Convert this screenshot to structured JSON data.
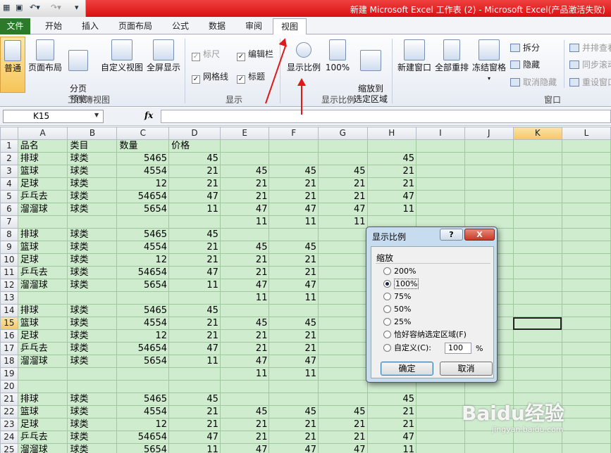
{
  "window": {
    "title": "新建 Microsoft Excel 工作表 (2) - Microsoft Excel(产品激活失败)"
  },
  "tabs": [
    {
      "label": "文件"
    },
    {
      "label": "开始"
    },
    {
      "label": "插入"
    },
    {
      "label": "页面布局"
    },
    {
      "label": "公式"
    },
    {
      "label": "数据"
    },
    {
      "label": "审阅"
    },
    {
      "label": "视图"
    }
  ],
  "ribbon": {
    "workbook_views": {
      "normal": "普通",
      "page_layout": "页面布局",
      "page_break": "分页\n预览",
      "custom_view": "自定义视图",
      "full_screen": "全屏显示",
      "group": "工作簿视图"
    },
    "show": {
      "ruler": "标尺",
      "formula_bar": "编辑栏",
      "gridlines": "网格线",
      "headings": "标题",
      "group": "显示"
    },
    "zoom": {
      "zoom": "显示比例",
      "zoom100": "100%",
      "zoom_selection": "缩放到\n选定区域",
      "group": "显示比例"
    },
    "window": {
      "new_window": "新建窗口",
      "arrange_all": "全部重排",
      "freeze": "冻结窗格",
      "split": "拆分",
      "hide": "隐藏",
      "unhide": "取消隐藏",
      "side_by_side": "并排查看",
      "sync_scroll": "同步滚动",
      "reset_pos": "重设窗口",
      "group": "窗口"
    }
  },
  "formula_bar": {
    "name_box": "K15",
    "fx": "fx",
    "value": ""
  },
  "columns": [
    "A",
    "B",
    "C",
    "D",
    "E",
    "F",
    "G",
    "H",
    "I",
    "J",
    "K",
    "L"
  ],
  "selected_column": "K",
  "selected_row": 15,
  "rows": [
    {
      "r": 1,
      "c": [
        "品名",
        "类目",
        "数量",
        "价格",
        "",
        "",
        "",
        "",
        ""
      ]
    },
    {
      "r": 2,
      "c": [
        "排球",
        "球类",
        "5465",
        "45",
        "",
        "",
        "",
        "45",
        ""
      ]
    },
    {
      "r": 3,
      "c": [
        "篮球",
        "球类",
        "4554",
        "21",
        "45",
        "45",
        "45",
        "21",
        ""
      ]
    },
    {
      "r": 4,
      "c": [
        "足球",
        "球类",
        "12",
        "21",
        "21",
        "21",
        "21",
        "21",
        ""
      ]
    },
    {
      "r": 5,
      "c": [
        "乒乓去",
        "球类",
        "54654",
        "47",
        "21",
        "21",
        "21",
        "47",
        ""
      ]
    },
    {
      "r": 6,
      "c": [
        "溜溜球",
        "球类",
        "5654",
        "11",
        "47",
        "47",
        "47",
        "11",
        ""
      ]
    },
    {
      "r": 7,
      "c": [
        "",
        "",
        "",
        "",
        "11",
        "11",
        "11",
        "",
        ""
      ]
    },
    {
      "r": 8,
      "c": [
        "排球",
        "球类",
        "5465",
        "45",
        "",
        "",
        "",
        "",
        ""
      ]
    },
    {
      "r": 9,
      "c": [
        "篮球",
        "球类",
        "4554",
        "21",
        "45",
        "45",
        "",
        "",
        ""
      ]
    },
    {
      "r": 10,
      "c": [
        "足球",
        "球类",
        "12",
        "21",
        "21",
        "21",
        "",
        "",
        ""
      ]
    },
    {
      "r": 11,
      "c": [
        "乒乓去",
        "球类",
        "54654",
        "47",
        "21",
        "21",
        "",
        "",
        ""
      ]
    },
    {
      "r": 12,
      "c": [
        "溜溜球",
        "球类",
        "5654",
        "11",
        "47",
        "47",
        "",
        "",
        ""
      ]
    },
    {
      "r": 13,
      "c": [
        "",
        "",
        "",
        "",
        "11",
        "11",
        "",
        "",
        ""
      ]
    },
    {
      "r": 14,
      "c": [
        "排球",
        "球类",
        "5465",
        "45",
        "",
        "",
        "",
        "",
        ""
      ]
    },
    {
      "r": 15,
      "c": [
        "篮球",
        "球类",
        "4554",
        "21",
        "45",
        "45",
        "",
        "",
        ""
      ]
    },
    {
      "r": 16,
      "c": [
        "足球",
        "球类",
        "12",
        "21",
        "21",
        "21",
        "",
        "",
        ""
      ]
    },
    {
      "r": 17,
      "c": [
        "乒乓去",
        "球类",
        "54654",
        "47",
        "21",
        "21",
        "",
        "",
        ""
      ]
    },
    {
      "r": 18,
      "c": [
        "溜溜球",
        "球类",
        "5654",
        "11",
        "47",
        "47",
        "",
        "",
        ""
      ]
    },
    {
      "r": 19,
      "c": [
        "",
        "",
        "",
        "",
        "11",
        "11",
        "",
        "",
        ""
      ]
    },
    {
      "r": 20,
      "c": [
        "",
        "",
        "",
        "",
        "",
        "",
        "",
        "",
        ""
      ]
    },
    {
      "r": 21,
      "c": [
        "排球",
        "球类",
        "5465",
        "45",
        "",
        "",
        "",
        "45",
        ""
      ]
    },
    {
      "r": 22,
      "c": [
        "篮球",
        "球类",
        "4554",
        "21",
        "45",
        "45",
        "45",
        "21",
        ""
      ]
    },
    {
      "r": 23,
      "c": [
        "足球",
        "球类",
        "12",
        "21",
        "21",
        "21",
        "21",
        "21",
        ""
      ]
    },
    {
      "r": 24,
      "c": [
        "乒乓去",
        "球类",
        "54654",
        "47",
        "21",
        "21",
        "21",
        "47",
        ""
      ]
    },
    {
      "r": 25,
      "c": [
        "溜溜球",
        "球类",
        "5654",
        "11",
        "47",
        "47",
        "47",
        "11",
        ""
      ]
    }
  ],
  "dialog": {
    "title": "显示比例",
    "help": "?",
    "close": "X",
    "legend": "缩放",
    "options": [
      "200%",
      "100%",
      "75%",
      "50%",
      "25%",
      "恰好容纳选定区域(F)",
      "自定义(C):"
    ],
    "selected": "100%",
    "custom_value": "100",
    "percent_sign": "%",
    "ok": "确定",
    "cancel": "取消"
  },
  "watermark": {
    "brand": "Baidu经验",
    "url": "jingyan.baidu.com"
  },
  "accent_colors": {
    "file_tab": "#2a7a2a",
    "title_bar": "#e02020",
    "sheet_bg": "#cfeccf",
    "annotation_arrow": "#e01818"
  }
}
